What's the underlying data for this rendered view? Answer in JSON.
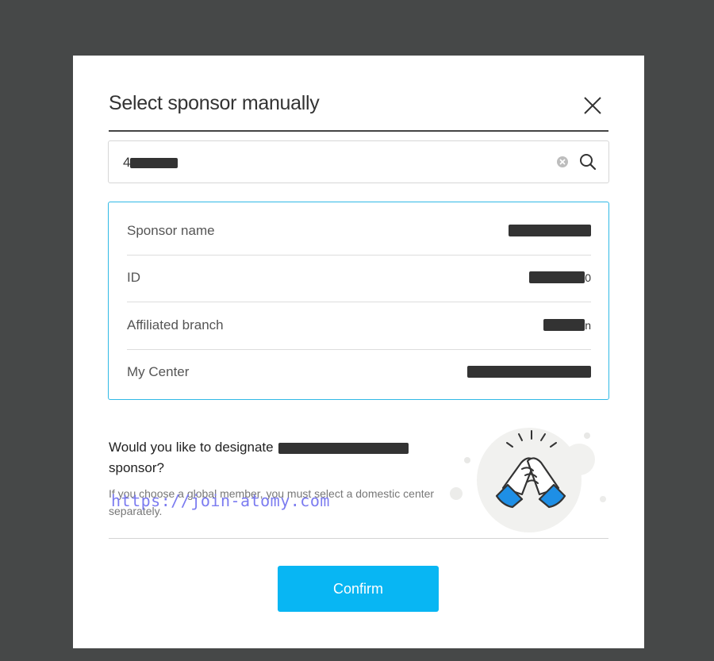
{
  "dialog": {
    "title": "Select sponsor manually",
    "close_icon": "close-icon"
  },
  "search": {
    "value_prefix": "4",
    "clear_icon": "clear-circle-icon",
    "search_icon": "search-icon"
  },
  "sponsor_info": {
    "rows": [
      {
        "label": "Sponsor name"
      },
      {
        "label": "ID",
        "value_suffix": "0"
      },
      {
        "label": "Affiliated branch",
        "value_suffix": "n"
      },
      {
        "label": "My Center"
      }
    ]
  },
  "prompt": {
    "question_start": "Would you like to designate",
    "question_end": "sponsor?",
    "note": "If you choose a global member, you must select a domestic center separately."
  },
  "watermark": "https://join-atomy.com",
  "illustration_icon": "handshake-icon",
  "confirm_label": "Confirm",
  "colors": {
    "backdrop": "#464848",
    "accent": "#08b6f3",
    "card_border": "#30b9e6"
  }
}
